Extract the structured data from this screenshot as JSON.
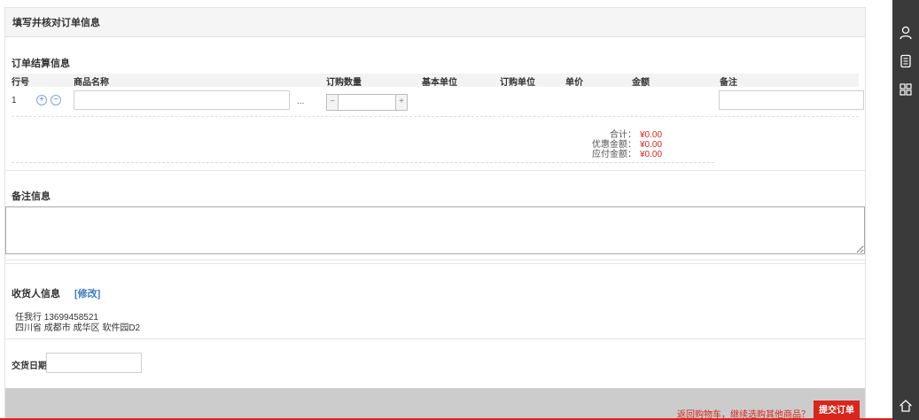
{
  "header": {
    "title": "填写并核对订单信息"
  },
  "order_settlement": {
    "title": "订单结算信息",
    "columns": [
      "行号",
      "商品名称",
      "订购数量",
      "基本单位",
      "订购单位",
      "单价",
      "金额",
      "备注"
    ],
    "row": {
      "no": "1",
      "add_icon": "plus-circle-icon",
      "remove_icon": "minus-circle-icon",
      "product_value": "",
      "browse_label": "...",
      "qty_minus": "−",
      "qty_plus": "+",
      "qty_value": "",
      "remark_value": ""
    },
    "totals": [
      {
        "label": "合计：",
        "value": "¥0.00"
      },
      {
        "label": "优惠金额：",
        "value": "¥0.00"
      },
      {
        "label": "应付金额：",
        "value": "¥0.00"
      }
    ]
  },
  "remarks": {
    "title": "备注信息",
    "value": ""
  },
  "receiver": {
    "title": "收货人信息",
    "modify_label": "[修改]",
    "line1": "任我行 13699458521",
    "line2": "四川省 成都市 成华区 软件园D2"
  },
  "delivery": {
    "label": "交货日期",
    "value": ""
  },
  "footer": {
    "back_link": "返回购物车，继续选购其他商品？",
    "submit_label": "提交订单"
  },
  "sidebar": {
    "icons": [
      "user-icon",
      "document-icon",
      "grid-icon",
      "home-icon"
    ],
    "background": "#3a3a3a"
  },
  "colors": {
    "accent": "#d9251c",
    "link": "#3b7ac4"
  }
}
